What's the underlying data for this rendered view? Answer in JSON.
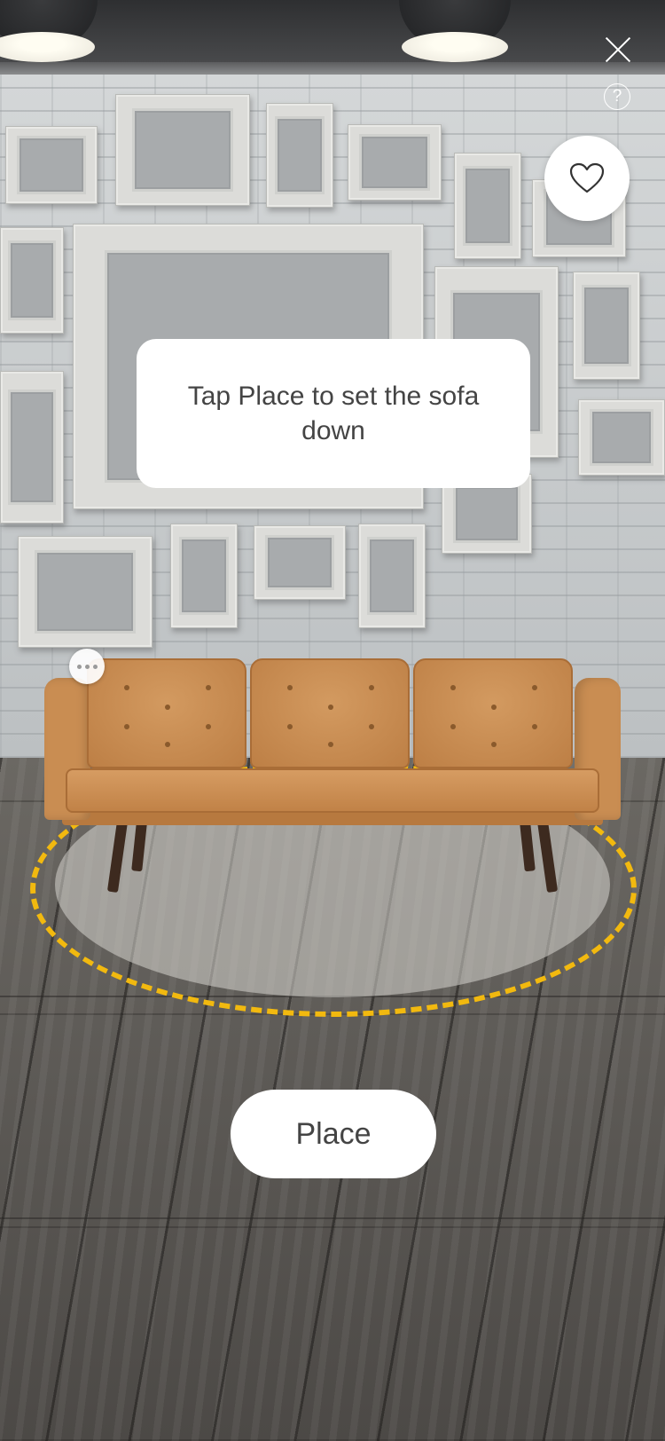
{
  "toast": {
    "message": "Tap Place to set the sofa down"
  },
  "controls": {
    "help_label": "?",
    "place_label": "Place",
    "close_icon": "close-icon",
    "help_icon": "help-icon",
    "favorite_icon": "heart-icon",
    "more_icon": "more-horizontal-icon"
  },
  "colors": {
    "placement_ring": "#f2b90f",
    "sofa_upholstery": "#c98d52",
    "button_bg": "#ffffff",
    "text": "#444444"
  }
}
